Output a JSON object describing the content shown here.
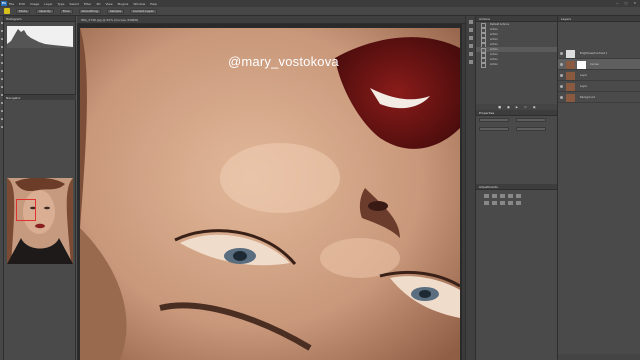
{
  "app": {
    "logo": "Ps"
  },
  "menu": {
    "items": [
      "File",
      "Edit",
      "Image",
      "Layer",
      "Type",
      "Select",
      "Filter",
      "3D",
      "View",
      "Plugins",
      "Window",
      "Help"
    ]
  },
  "window_controls": [
    "—",
    "□",
    "✕"
  ],
  "options": {
    "labels": [
      "Mode",
      "Opacity",
      "Flow",
      "Smoothing",
      "Sample",
      "Current Layer"
    ]
  },
  "panels": {
    "histogram_tab": "Histogram",
    "navigator_tab": "Navigator",
    "actions_tab": "Actions",
    "properties_tab": "Properties",
    "adjustments_tab": "Adjustments",
    "layers_tab": "Layers"
  },
  "document": {
    "tab_title": "IMG_2746.jpg @ 50% (Curves, RGB/8)"
  },
  "watermark": "@mary_vostokova",
  "actions": [
    {
      "label": "Default Actions"
    },
    {
      "label": "Action"
    },
    {
      "label": "Action"
    },
    {
      "label": "Action"
    },
    {
      "label": "Action"
    },
    {
      "label": "Action",
      "selected": true
    },
    {
      "label": "Action"
    },
    {
      "label": "Action"
    },
    {
      "label": "Action"
    }
  ],
  "layers": [
    {
      "name": "Brightness/Contrast 1",
      "kind": "adj"
    },
    {
      "name": "Curves",
      "kind": "mask",
      "selected": true
    },
    {
      "name": "Layer",
      "kind": "pixel"
    },
    {
      "name": "Layer",
      "kind": "pixel"
    },
    {
      "name": "Background",
      "kind": "pixel"
    }
  ],
  "colors": {
    "accent_yellow": "#d8c21a",
    "panel_bg": "#4a4a4a",
    "menu_bg": "#3c3c3c"
  }
}
